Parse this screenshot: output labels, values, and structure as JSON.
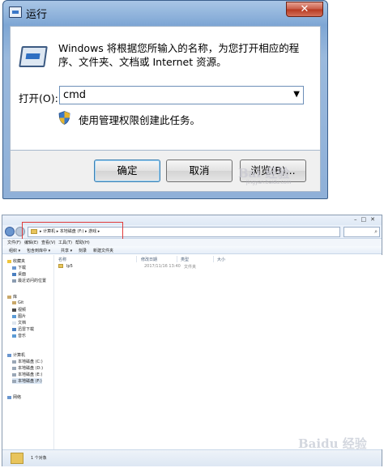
{
  "run_dialog": {
    "title": "运行",
    "close_glyph": "✕",
    "description": "Windows 将根据您所输入的名称，为您打开相应的程序、文件夹、文档或 Internet 资源。",
    "open_label": "打开(O):",
    "open_value": "cmd",
    "dropdown_glyph": "▼",
    "admin_note": "使用管理权限创建此任务。",
    "buttons": {
      "ok": "确定",
      "cancel": "取消",
      "browse": "浏览(B)..."
    }
  },
  "watermarks": {
    "top": "Bai 经验",
    "top_sub": "jingyan.baidu.com",
    "bottom": "Baidu 经验",
    "bottom_sub": "jingyan.baidu.com"
  },
  "explorer": {
    "window_buttons": "–□✕",
    "address": "▸ 计算机 ▸ 本地磁盘 (F:) ▸ 游戏 ▸",
    "menu": [
      "文件(F)",
      "编辑(E)",
      "查看(V)",
      "工具(T)",
      "帮助(H)"
    ],
    "toolbar": [
      "组织 ▾",
      "包含到库中 ▾",
      "共享 ▾",
      "刻录",
      "新建文件夹"
    ],
    "columns": [
      "名称",
      "修改日期",
      "类型",
      "大小"
    ],
    "nav_groups": {
      "favorites": {
        "title": "收藏夹",
        "items": [
          "下载",
          "桌面",
          "最近访问的位置"
        ]
      },
      "libraries": {
        "title": "库",
        "items": [
          "Git",
          "视频",
          "图片",
          "文档",
          "迅雷下载",
          "音乐"
        ]
      },
      "computer": {
        "title": "计算机",
        "items": [
          "本地磁盘 (C:)",
          "本地磁盘 (D:)",
          "本地磁盘 (E:)",
          "本地磁盘 (F:)"
        ]
      },
      "network": {
        "title": "网络"
      }
    },
    "files": [
      {
        "name": "lp5",
        "date": "2017/11/16 13:40",
        "type": "文件夹",
        "size": ""
      }
    ],
    "status": "1 个对象"
  },
  "colors": {
    "highlight": "#e03a3a",
    "folder": "#e8c45c",
    "title_gradient": "#7ea6d4"
  }
}
